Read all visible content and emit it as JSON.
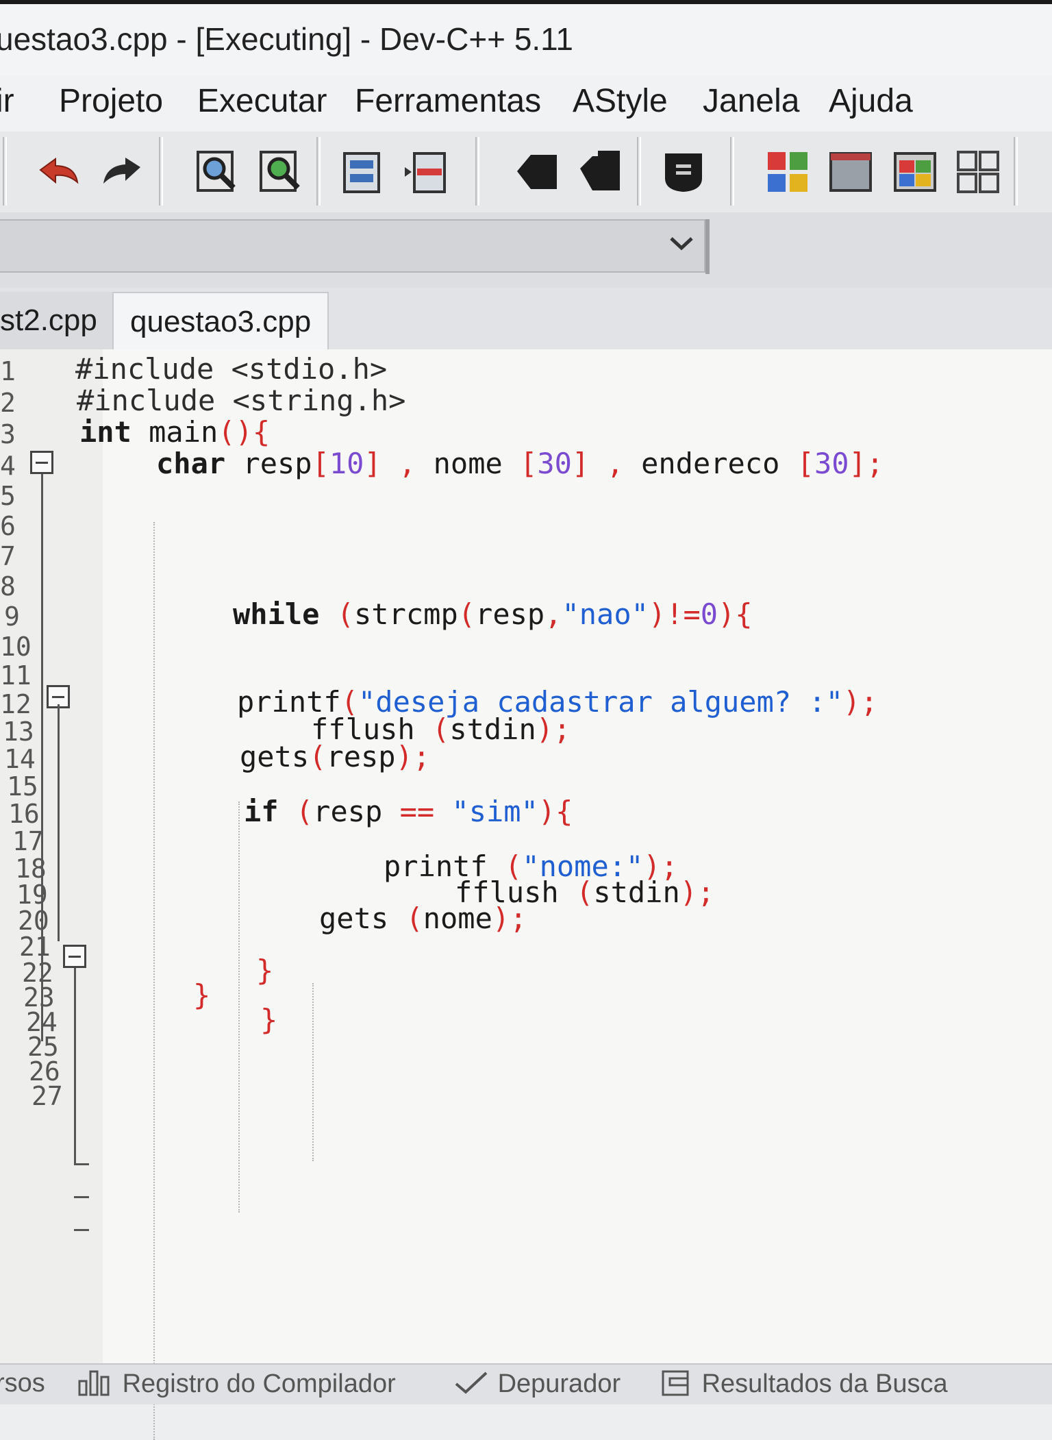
{
  "window": {
    "title": "uestao3.cpp - [Executing] - Dev-C++ 5.11"
  },
  "menu": [
    "ir",
    "Projeto",
    "Executar",
    "Ferramentas",
    "AStyle",
    "Janela",
    "Ajuda"
  ],
  "toolbar": {
    "icons": [
      "undo-icon",
      "redo-icon",
      "find-icon",
      "replace-icon",
      "bookmark-icon",
      "goto-icon",
      "indent-icon",
      "unindent-icon",
      "comment-icon",
      "new-class-icon",
      "project-window-icon",
      "colors-icon",
      "layout-icon"
    ]
  },
  "tabs": [
    {
      "label": "st2.cpp",
      "active": false
    },
    {
      "label": "questao3.cpp",
      "active": true
    }
  ],
  "editor": {
    "line_numbers": [
      "1",
      "2",
      "3",
      "4",
      "5",
      "6",
      "7",
      "8",
      "9",
      "10",
      "11",
      "12",
      "13",
      "14",
      "15",
      "16",
      "17",
      "18",
      "19",
      "20",
      "21",
      "22",
      "23",
      "24",
      "25",
      "26",
      "27"
    ],
    "lines": [
      {
        "parts": [
          {
            "t": "#include <stdio.h>",
            "c": "pre"
          }
        ]
      },
      {
        "parts": [
          {
            "t": "#include <string.h>",
            "c": "pre"
          }
        ]
      },
      {
        "parts": [
          {
            "t": "int",
            "c": "kw"
          },
          {
            "t": " main",
            "c": ""
          },
          {
            "t": "(){",
            "c": "sym"
          }
        ]
      },
      {
        "parts": [
          {
            "t": "char",
            "c": "kw"
          },
          {
            "t": " resp",
            "c": ""
          },
          {
            "t": "[",
            "c": "sym"
          },
          {
            "t": "10",
            "c": "num"
          },
          {
            "t": "]",
            "c": "sym"
          },
          {
            "t": " , ",
            "c": "sym"
          },
          {
            "t": "nome ",
            "c": ""
          },
          {
            "t": "[",
            "c": "sym"
          },
          {
            "t": "30",
            "c": "num"
          },
          {
            "t": "]",
            "c": "sym"
          },
          {
            "t": " , ",
            "c": "sym"
          },
          {
            "t": "endereco ",
            "c": ""
          },
          {
            "t": "[",
            "c": "sym"
          },
          {
            "t": "30",
            "c": "num"
          },
          {
            "t": "];",
            "c": "sym"
          }
        ]
      },
      {
        "parts": []
      },
      {
        "parts": []
      },
      {
        "parts": []
      },
      {
        "parts": []
      },
      {
        "parts": [
          {
            "t": "while",
            "c": "kw"
          },
          {
            "t": " (",
            "c": "sym"
          },
          {
            "t": "strcmp",
            "c": ""
          },
          {
            "t": "(",
            "c": "sym"
          },
          {
            "t": "resp",
            "c": ""
          },
          {
            "t": ",",
            "c": "sym"
          },
          {
            "t": "\"nao\"",
            "c": "str"
          },
          {
            "t": ")!=",
            "c": "sym"
          },
          {
            "t": "0",
            "c": "num"
          },
          {
            "t": "){",
            "c": "sym"
          }
        ]
      },
      {
        "parts": []
      },
      {
        "parts": []
      },
      {
        "parts": [
          {
            "t": "printf",
            "c": ""
          },
          {
            "t": "(",
            "c": "sym"
          },
          {
            "t": "\"deseja cadastrar alguem? :\"",
            "c": "str"
          },
          {
            "t": ");",
            "c": "sym"
          }
        ]
      },
      {
        "parts": [
          {
            "t": "fflush ",
            "c": ""
          },
          {
            "t": "(",
            "c": "sym"
          },
          {
            "t": "stdin",
            "c": ""
          },
          {
            "t": ");",
            "c": "sym"
          }
        ]
      },
      {
        "parts": [
          {
            "t": "gets",
            "c": ""
          },
          {
            "t": "(",
            "c": "sym"
          },
          {
            "t": "resp",
            "c": ""
          },
          {
            "t": ");",
            "c": "sym"
          }
        ]
      },
      {
        "parts": []
      },
      {
        "parts": [
          {
            "t": "if",
            "c": "kw"
          },
          {
            "t": " (",
            "c": "sym"
          },
          {
            "t": "resp ",
            "c": ""
          },
          {
            "t": "== ",
            "c": "sym"
          },
          {
            "t": "\"sim\"",
            "c": "str"
          },
          {
            "t": "){",
            "c": "sym"
          }
        ]
      },
      {
        "parts": []
      },
      {
        "parts": [
          {
            "t": "printf ",
            "c": ""
          },
          {
            "t": "(",
            "c": "sym"
          },
          {
            "t": "\"nome:\"",
            "c": "str"
          },
          {
            "t": ");",
            "c": "sym"
          }
        ]
      },
      {
        "parts": [
          {
            "t": "fflush ",
            "c": ""
          },
          {
            "t": "(",
            "c": "sym"
          },
          {
            "t": "stdin",
            "c": ""
          },
          {
            "t": ");",
            "c": "sym"
          }
        ]
      },
      {
        "parts": [
          {
            "t": "gets ",
            "c": ""
          },
          {
            "t": "(",
            "c": "sym"
          },
          {
            "t": "nome",
            "c": ""
          },
          {
            "t": ");",
            "c": "sym"
          }
        ]
      },
      {
        "parts": []
      },
      {
        "parts": [
          {
            "t": "}",
            "c": "sym"
          }
        ]
      },
      {
        "parts": [
          {
            "t": "}",
            "c": "sym"
          }
        ]
      },
      {
        "parts": [
          {
            "t": "}",
            "c": "sym"
          }
        ]
      },
      {
        "parts": []
      },
      {
        "parts": []
      },
      {
        "parts": []
      }
    ]
  },
  "bottom_tabs": [
    "rsos",
    "Registro do Compilador",
    "Depurador",
    "Resultados da Busca"
  ]
}
